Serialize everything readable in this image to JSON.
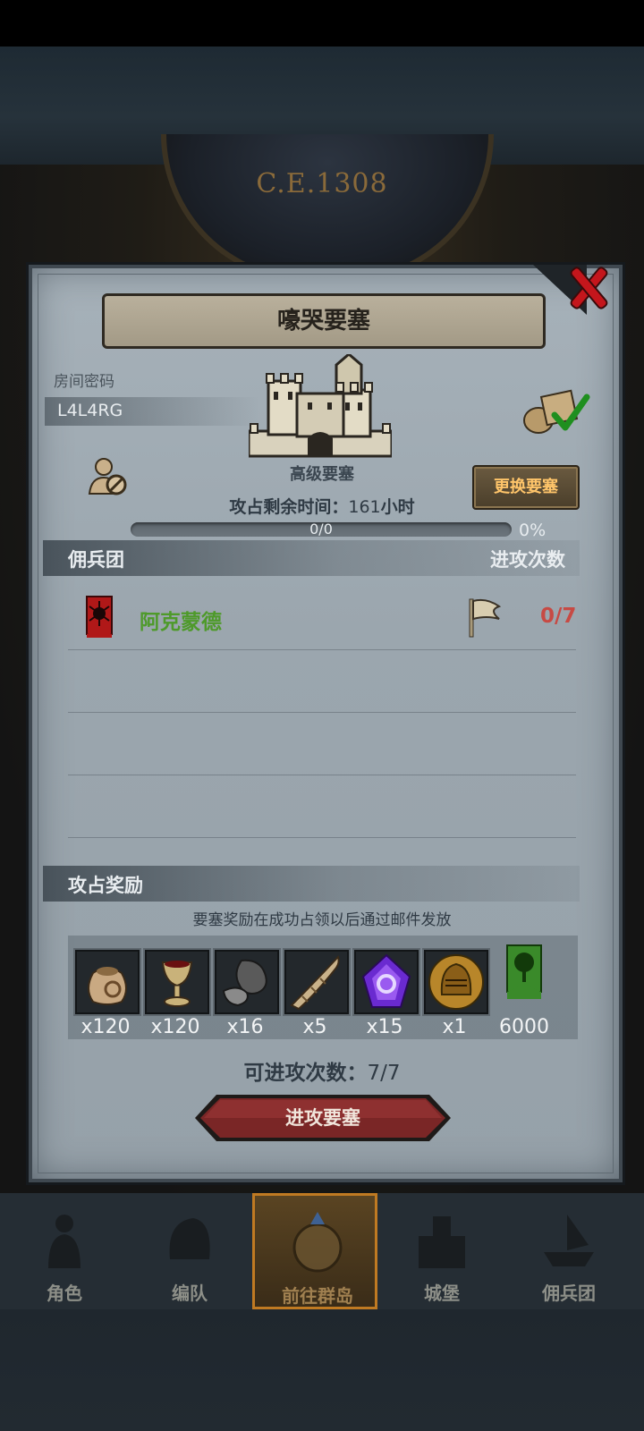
{
  "background": {
    "year_label": "C.E.1308"
  },
  "dialog": {
    "title": "嚎哭要塞",
    "room_code_label": "房间密码",
    "room_code_value": "L4L4RG",
    "fortress_type": "高级要塞",
    "change_fortress_label": "更换要塞",
    "occupation_time_label": "攻占剩余时间：",
    "occupation_time_value": "161",
    "occupation_time_unit": "小时",
    "progress": {
      "text": "0/0",
      "percent_label": "0%",
      "fraction": 0
    },
    "mercenary_section": {
      "title": "佣兵团",
      "right_title": "进攻次数",
      "rows": [
        {
          "name": "阿克蒙德",
          "attacks": "0/7"
        }
      ]
    },
    "reward_section": {
      "title": "攻占奖励",
      "note": "要塞奖励在成功占领以后通过邮件发放",
      "items": [
        {
          "icon": "sack-icon",
          "qty": "x120"
        },
        {
          "icon": "goblet-icon",
          "qty": "x120"
        },
        {
          "icon": "ore-icon",
          "qty": "x16"
        },
        {
          "icon": "horn-icon",
          "qty": "x5"
        },
        {
          "icon": "purple-gem-icon",
          "qty": "x15"
        },
        {
          "icon": "knight-helmet-icon",
          "qty": "x1"
        },
        {
          "icon": "tree-banner-icon",
          "qty": "6000"
        }
      ]
    },
    "attack_count_label": "可进攻次数：",
    "attack_count_value": "7/7",
    "attack_button_label": "进攻要塞"
  },
  "bottom_nav": {
    "items": [
      {
        "label": "角色",
        "icon": "knight-icon"
      },
      {
        "label": "编队",
        "icon": "helmet-icon"
      },
      {
        "label": "前往群岛",
        "icon": "compass-icon",
        "active": true
      },
      {
        "label": "城堡",
        "icon": "castle-icon"
      },
      {
        "label": "佣兵团",
        "icon": "ship-icon"
      }
    ]
  },
  "colors": {
    "panel": "#9ba6ae",
    "accent_gold": "#ffc56a",
    "mercenary_name": "#4e9a2a",
    "attack_count_red": "#c74a44",
    "close_red": "#c4161c",
    "attack_button": "#7a2626"
  }
}
